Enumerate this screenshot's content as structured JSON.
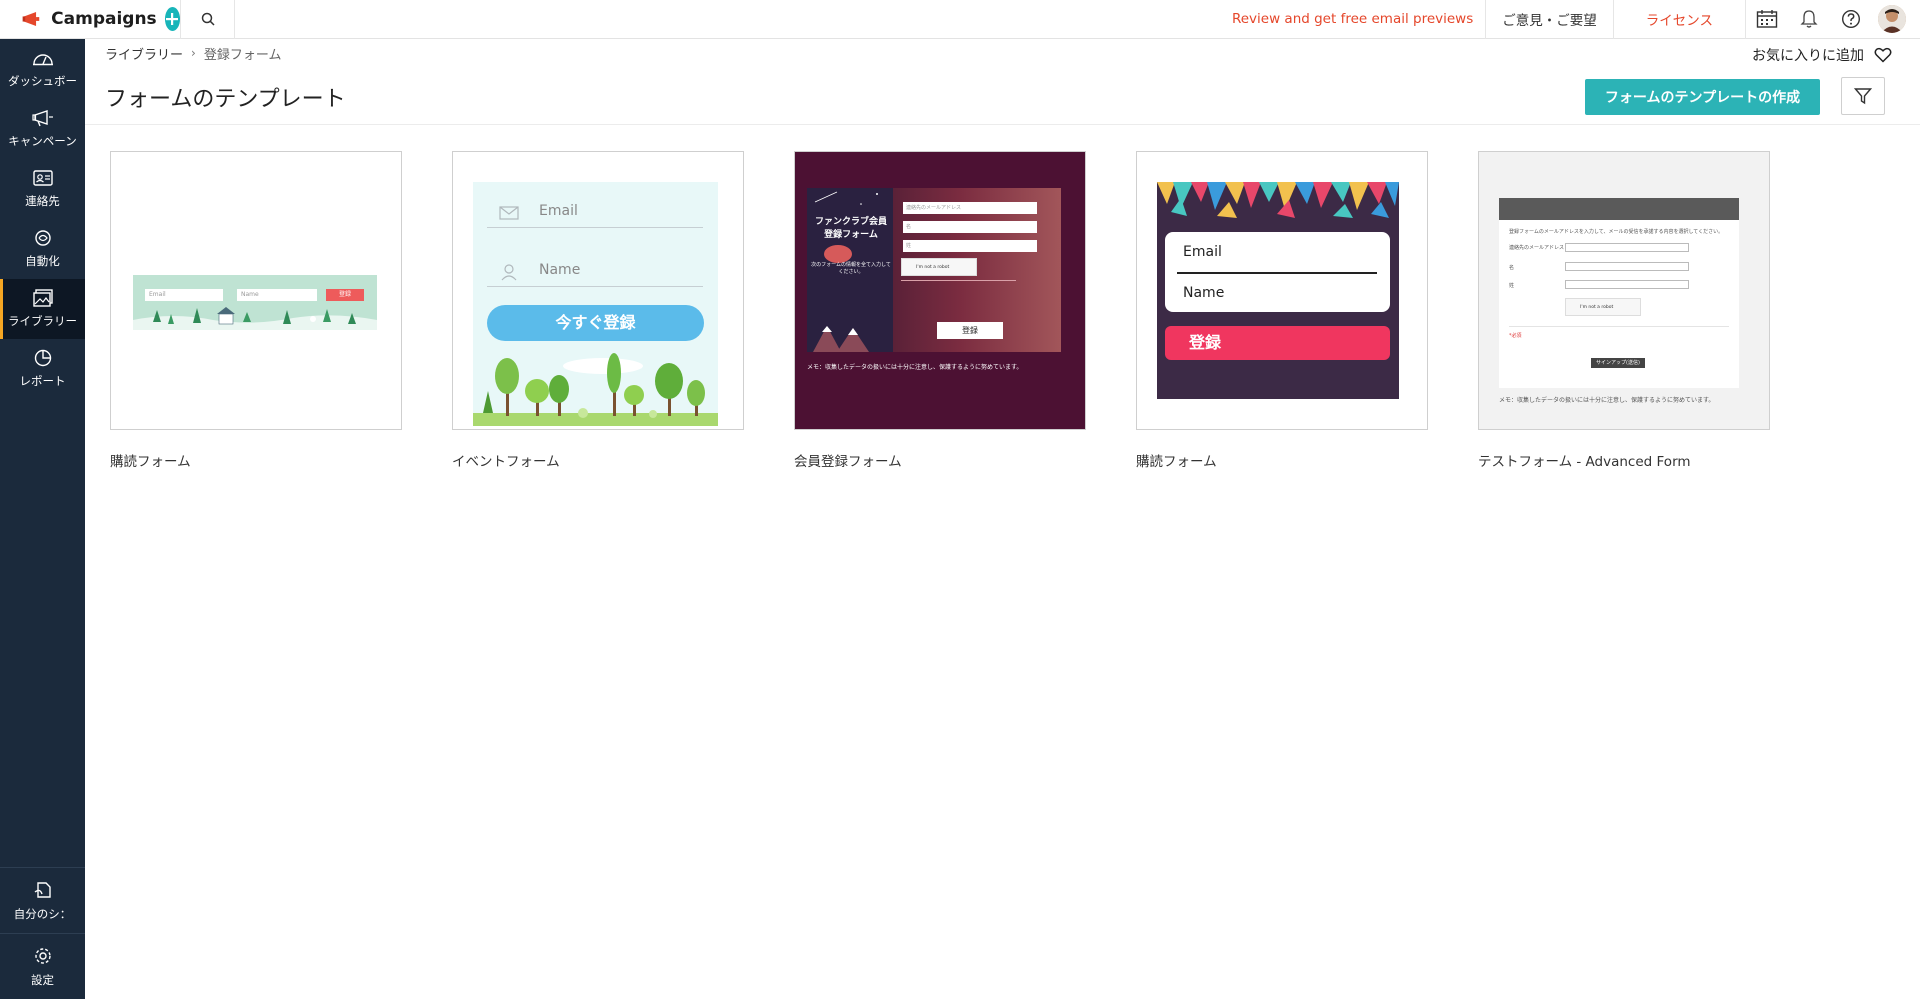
{
  "app": {
    "name": "Campaigns",
    "brand_color": "#e5472b",
    "accent": "#2cb3b6"
  },
  "header": {
    "promo": "Review and get free email previews",
    "feedback": "ご意見・ご要望",
    "license": "ライセンス"
  },
  "sidebar": {
    "items": [
      {
        "label": "ダッシュボー",
        "icon": "dashboard-icon"
      },
      {
        "label": "キャンペーン",
        "icon": "megaphone-icon"
      },
      {
        "label": "連絡先",
        "icon": "contacts-icon"
      },
      {
        "label": "自動化",
        "icon": "automation-icon"
      },
      {
        "label": "ライブラリー",
        "icon": "library-icon",
        "active": true
      },
      {
        "label": "レポート",
        "icon": "report-icon"
      }
    ],
    "bottom": [
      {
        "label": "自分のシ：",
        "icon": "signup-icon"
      },
      {
        "label": "設定",
        "icon": "gear-icon"
      }
    ]
  },
  "breadcrumb": {
    "parent": "ライブラリー",
    "current": "登録フォーム"
  },
  "favorite": {
    "label": "お気に入りに追加"
  },
  "page": {
    "title": "フォームのテンプレート",
    "create_button": "フォームのテンプレートの作成"
  },
  "templates": [
    {
      "label": "購読フォーム",
      "preview": {
        "email": "Email",
        "name": "Name",
        "button": "登録"
      }
    },
    {
      "label": "イベントフォーム",
      "preview": {
        "email": "Email",
        "name": "Name",
        "button": "今すぐ登録"
      }
    },
    {
      "label": "会員登録フォーム",
      "preview": {
        "title": "ファンクラブ会員登録フォーム",
        "subtitle": "次のフォームの情報を全て入力してください。",
        "field1": "連絡先のメールアドレス",
        "field2": "名",
        "field3": "姓",
        "captcha": "I'm not a robot",
        "button": "登録",
        "note": "メモ：収集したデータの扱いには十分に注意し、保護するように努めています。"
      }
    },
    {
      "label": "購読フォーム",
      "preview": {
        "email": "Email",
        "name": "Name",
        "button": "登録"
      }
    },
    {
      "label": "テストフォーム - Advanced Form",
      "preview": {
        "intro": "登録フォームのメールアドレスを入力して、メールの受信を承諾する内容を選択してください。",
        "field1": "連絡先のメールアドレス *",
        "field2": "名",
        "field3": "姓",
        "captcha": "I'm not a robot",
        "required": "*必須",
        "button": "サインアップ(送信)",
        "note": "メモ：収集したデータの扱いには十分に注意し、保護するように努めています。"
      }
    }
  ]
}
